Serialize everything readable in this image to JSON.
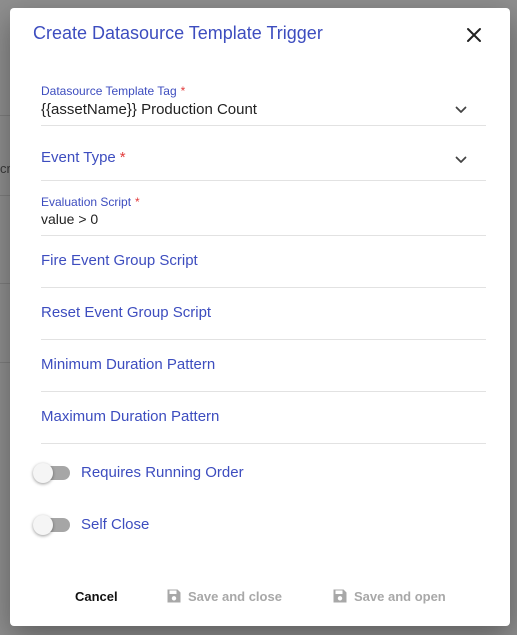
{
  "dialog": {
    "title": "Create Datasource Template Trigger"
  },
  "background": {
    "fragment": "cr"
  },
  "fields": {
    "datasource_template_tag": {
      "label": "Datasource Template Tag",
      "required_mark": "*",
      "value": "{{assetName}} Production Count"
    },
    "event_type": {
      "label": "Event Type",
      "required_mark": "*"
    },
    "evaluation_script": {
      "label": "Evaluation Script",
      "required_mark": "*",
      "value": "value > 0"
    }
  },
  "links": {
    "fire_event_group_script": "Fire Event Group Script",
    "reset_event_group_script": "Reset Event Group Script",
    "minimum_duration_pattern": "Minimum Duration Pattern",
    "maximum_duration_pattern": "Maximum Duration Pattern"
  },
  "toggles": {
    "requires_running_order": {
      "label": "Requires Running Order",
      "on": false
    },
    "self_close": {
      "label": "Self Close",
      "on": false
    }
  },
  "actions": {
    "cancel": "Cancel",
    "save_and_close": "Save and close",
    "save_and_open": "Save and open"
  },
  "colors": {
    "accent": "#3d4dbf",
    "required": "#e23b3b",
    "disabled": "#a8a8a8"
  },
  "icons": {
    "close": "close-icon",
    "dropdown": "chevron-down-icon",
    "save": "save-icon"
  }
}
